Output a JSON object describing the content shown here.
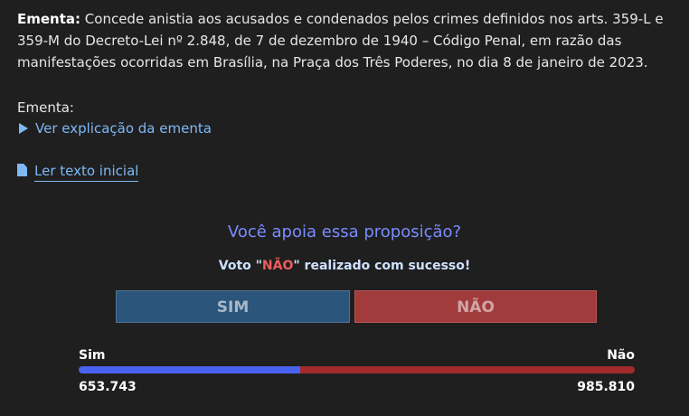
{
  "ementa": {
    "label": "Ementa:",
    "text": " Concede anistia aos acusados e condenados pelos crimes definidos nos arts. 359-L e 359-M do Decreto-Lei nº 2.848, de 7 de dezembro de 1940 – Código Penal, em razão das manifestações ocorridas em Brasília, na Praça dos Três Poderes, no dia 8 de janeiro de 2023."
  },
  "ementa_section_label": "Ementa:",
  "toggle_label": "Ver explicação da ementa",
  "link_label": "Ler texto inicial",
  "vote": {
    "question": "Você apoia essa proposição?",
    "success_prefix": "Voto \"",
    "success_choice": "NÃO",
    "success_suffix": "\" realizado com sucesso!",
    "sim_label": "SIM",
    "nao_label": "NÃO"
  },
  "results": {
    "sim_label": "Sim",
    "nao_label": "Não",
    "sim_count": "653.743",
    "nao_count": "985.810",
    "sim_fraction": 0.399
  },
  "colors": {
    "sim": "#4a62f0",
    "nao": "#a12a2a",
    "link": "#7fb8f5"
  }
}
